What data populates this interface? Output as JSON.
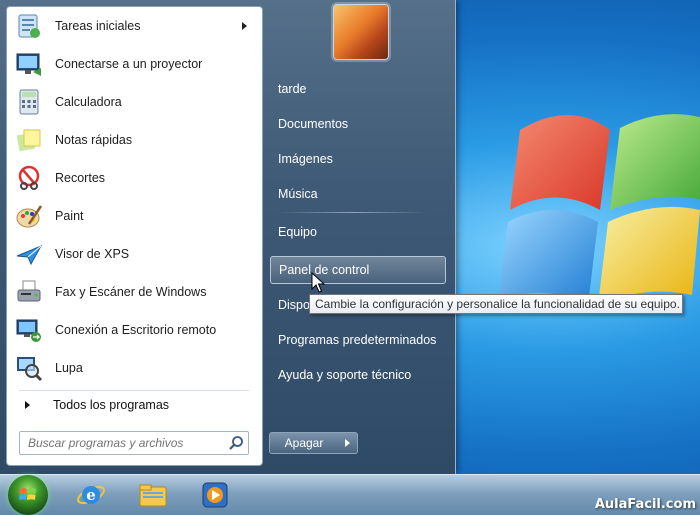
{
  "start_menu": {
    "programs": [
      {
        "label": "Tareas iniciales",
        "icon": "getting-started-icon",
        "has_submenu": true
      },
      {
        "label": "Conectarse a un proyector",
        "icon": "projector-icon"
      },
      {
        "label": "Calculadora",
        "icon": "calculator-icon"
      },
      {
        "label": "Notas rápidas",
        "icon": "sticky-notes-icon"
      },
      {
        "label": "Recortes",
        "icon": "snipping-tool-icon"
      },
      {
        "label": "Paint",
        "icon": "paint-icon"
      },
      {
        "label": "Visor de XPS",
        "icon": "xps-viewer-icon"
      },
      {
        "label": "Fax y Escáner de Windows",
        "icon": "fax-scanner-icon"
      },
      {
        "label": "Conexión a Escritorio remoto",
        "icon": "remote-desktop-icon"
      },
      {
        "label": "Lupa",
        "icon": "magnifier-icon"
      }
    ],
    "all_programs_label": "Todos los programas",
    "search_placeholder": "Buscar programas y archivos",
    "right_items": {
      "user": "tarde",
      "documents": "Documentos",
      "pictures": "Imágenes",
      "music": "Música",
      "computer": "Equipo",
      "control_panel": "Panel de control",
      "devices": "Dispo",
      "default_programs": "Programas predeterminados",
      "help": "Ayuda y soporte técnico"
    },
    "shutdown_label": "Apagar"
  },
  "tooltip": "Cambie la configuración y personalice la funcionalidad de su equipo.",
  "taskbar": {
    "pinned": [
      "internet-explorer-icon",
      "windows-explorer-icon",
      "media-player-icon"
    ]
  },
  "watermark": "AulaFacil.com",
  "colors": {
    "accent": "#1570c4",
    "menu": "#3e5a76"
  }
}
